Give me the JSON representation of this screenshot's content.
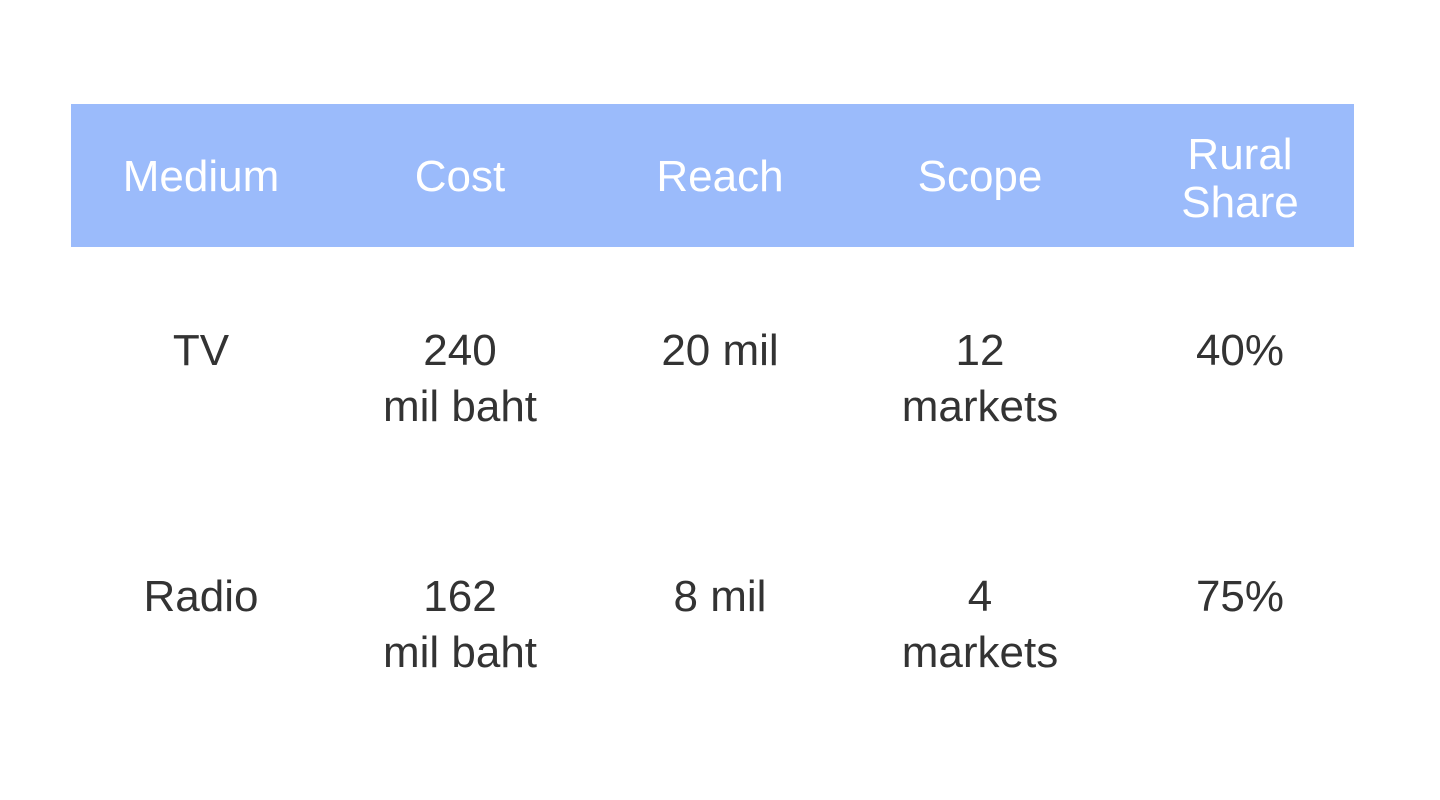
{
  "table": {
    "headers": [
      {
        "lines": [
          "Medium"
        ]
      },
      {
        "lines": [
          "Cost"
        ]
      },
      {
        "lines": [
          "Reach"
        ]
      },
      {
        "lines": [
          "Scope"
        ]
      },
      {
        "lines": [
          "Rural",
          "Share"
        ]
      }
    ],
    "rows": [
      {
        "medium": "TV",
        "cost": [
          "240",
          "mil baht"
        ],
        "reach": "20 mil",
        "scope": [
          "12",
          "markets"
        ],
        "rural_share": "40%"
      },
      {
        "medium": "Radio",
        "cost": [
          "162",
          "mil baht"
        ],
        "reach": "8 mil",
        "scope": [
          "4",
          "markets"
        ],
        "rural_share": "75%"
      }
    ]
  },
  "colors": {
    "header_background": "#9bbbfb",
    "header_text": "#ffffff",
    "body_text": "#333333"
  }
}
